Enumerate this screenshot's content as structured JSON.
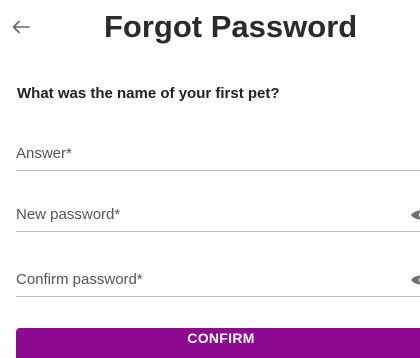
{
  "header": {
    "title": "Forgot Password",
    "back_icon": "arrow-left-icon"
  },
  "form": {
    "question": "What was the name of your first pet?",
    "answer": {
      "placeholder": "Answer*",
      "value": ""
    },
    "new_password": {
      "placeholder": "New password*",
      "value": "",
      "icon": "eye-icon"
    },
    "confirm_password": {
      "placeholder": "Confirm password*",
      "value": "",
      "icon": "eye-icon"
    },
    "confirm_label": "CONFIRM"
  },
  "colors": {
    "accent": "#8e0a91",
    "title_text": "#2b2b2b",
    "placeholder_text": "#555555",
    "divider": "#b7b7b7"
  }
}
